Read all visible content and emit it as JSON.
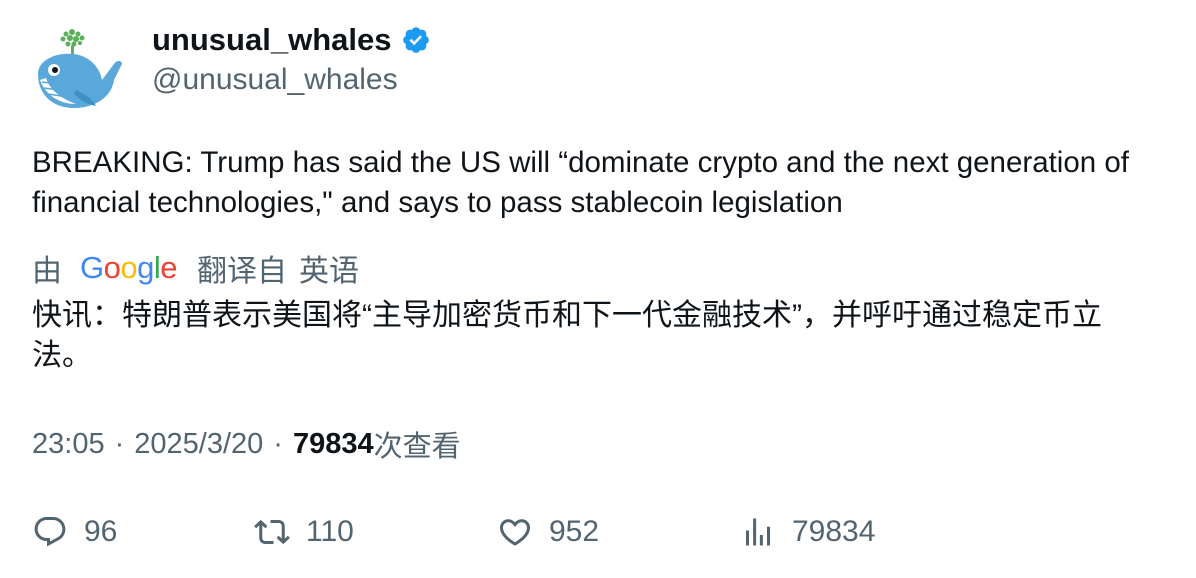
{
  "author": {
    "display_name": "unusual_whales",
    "handle": "@unusual_whales",
    "verified": true,
    "avatar_icon": "whale-logo-icon"
  },
  "tweet": {
    "text": "BREAKING: Trump has said the US will “dominate crypto and the next generation of financial technologies,\" and says to pass stablecoin legislation"
  },
  "translation": {
    "by_label": "由",
    "provider_logo_text": "Google",
    "translated_from_label": "翻译自",
    "source_language": "英语",
    "text": "快讯：特朗普表示美国将“主导加密货币和下一代金融技术”，并呼吁通过稳定币立法。"
  },
  "meta": {
    "time": "23:05",
    "separator": "·",
    "date": "2025/3/20",
    "views_count": "79834",
    "views_label": "次查看"
  },
  "actions": {
    "replies": "96",
    "retweets": "110",
    "likes": "952",
    "views": "79834"
  },
  "colors": {
    "text_primary": "#0f1419",
    "text_secondary": "#536471",
    "verified_blue": "#1d9bf0",
    "google_blue": "#4285F4",
    "google_red": "#EA4335",
    "google_yellow": "#FBBC05",
    "google_green": "#34A853"
  }
}
